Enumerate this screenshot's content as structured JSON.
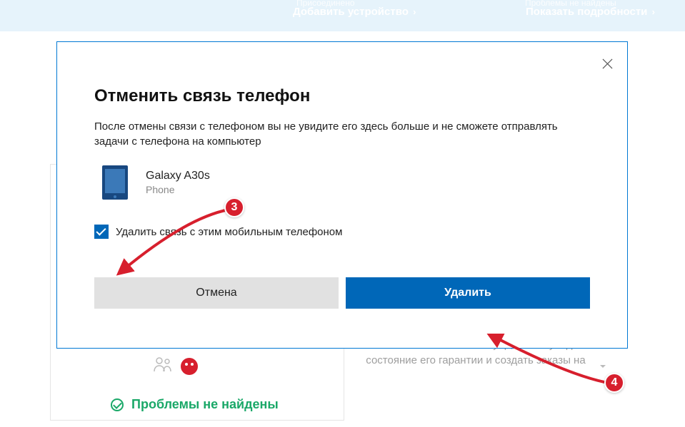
{
  "top": {
    "fade1": "Присоединено",
    "link1": "Добавить устройство",
    "fade2": "Проблемы не найдены",
    "link2": "Показать подробности"
  },
  "dialog": {
    "title": "Отменить связь телефон",
    "description": "После отмены связи с телефоном вы не увидите его здесь больше и не сможете отправлять задачи с телефона на компьютер",
    "device_name": "Galaxy A30s",
    "device_type": "Phone",
    "checkbox_label": "Удалить связь с этим мобильным телефоном",
    "cancel_label": "Отмена",
    "delete_label": "Удалить"
  },
  "bg": {
    "card_text": "Зарегистрируйте свое устройство Surface, Xbox или связанный аксессуар, чтобы увидеть состояние его гарантии и создать заказы на",
    "nofound": "Проблемы не найдены"
  },
  "annotations": {
    "tag3": "3",
    "tag4": "4"
  }
}
